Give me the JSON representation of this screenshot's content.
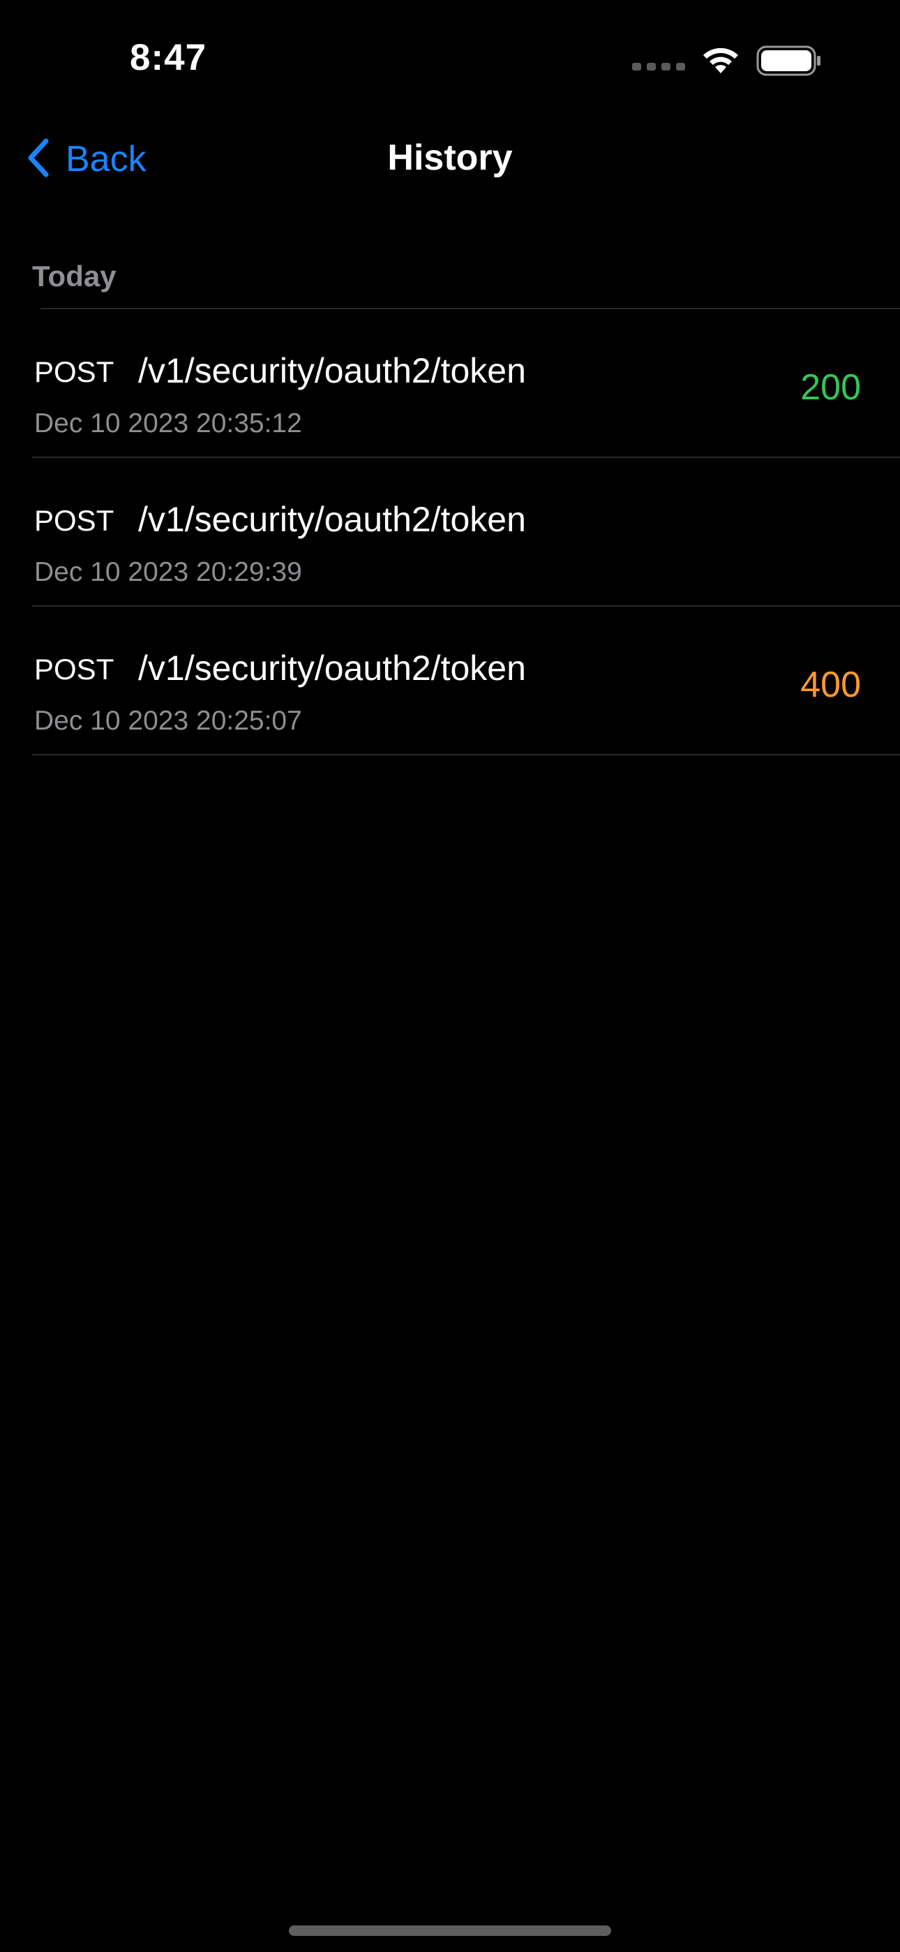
{
  "status_bar": {
    "time": "8:47"
  },
  "nav": {
    "back_label": "Back",
    "title": "History"
  },
  "section": {
    "header": "Today"
  },
  "colors": {
    "accent": "#1a84ff",
    "status_success": "#34c759",
    "status_error": "#ff9a2e",
    "secondary_text": "#8e8e93"
  },
  "history": [
    {
      "method": "POST",
      "path": "/v1/security/oauth2/token",
      "date": "Dec 10 2023 20:35:12",
      "status": "200",
      "status_kind": "success"
    },
    {
      "method": "POST",
      "path": "/v1/security/oauth2/token",
      "date": "Dec 10 2023 20:29:39",
      "status": "",
      "status_kind": "none"
    },
    {
      "method": "POST",
      "path": "/v1/security/oauth2/token",
      "date": "Dec 10 2023 20:25:07",
      "status": "400",
      "status_kind": "error"
    }
  ]
}
